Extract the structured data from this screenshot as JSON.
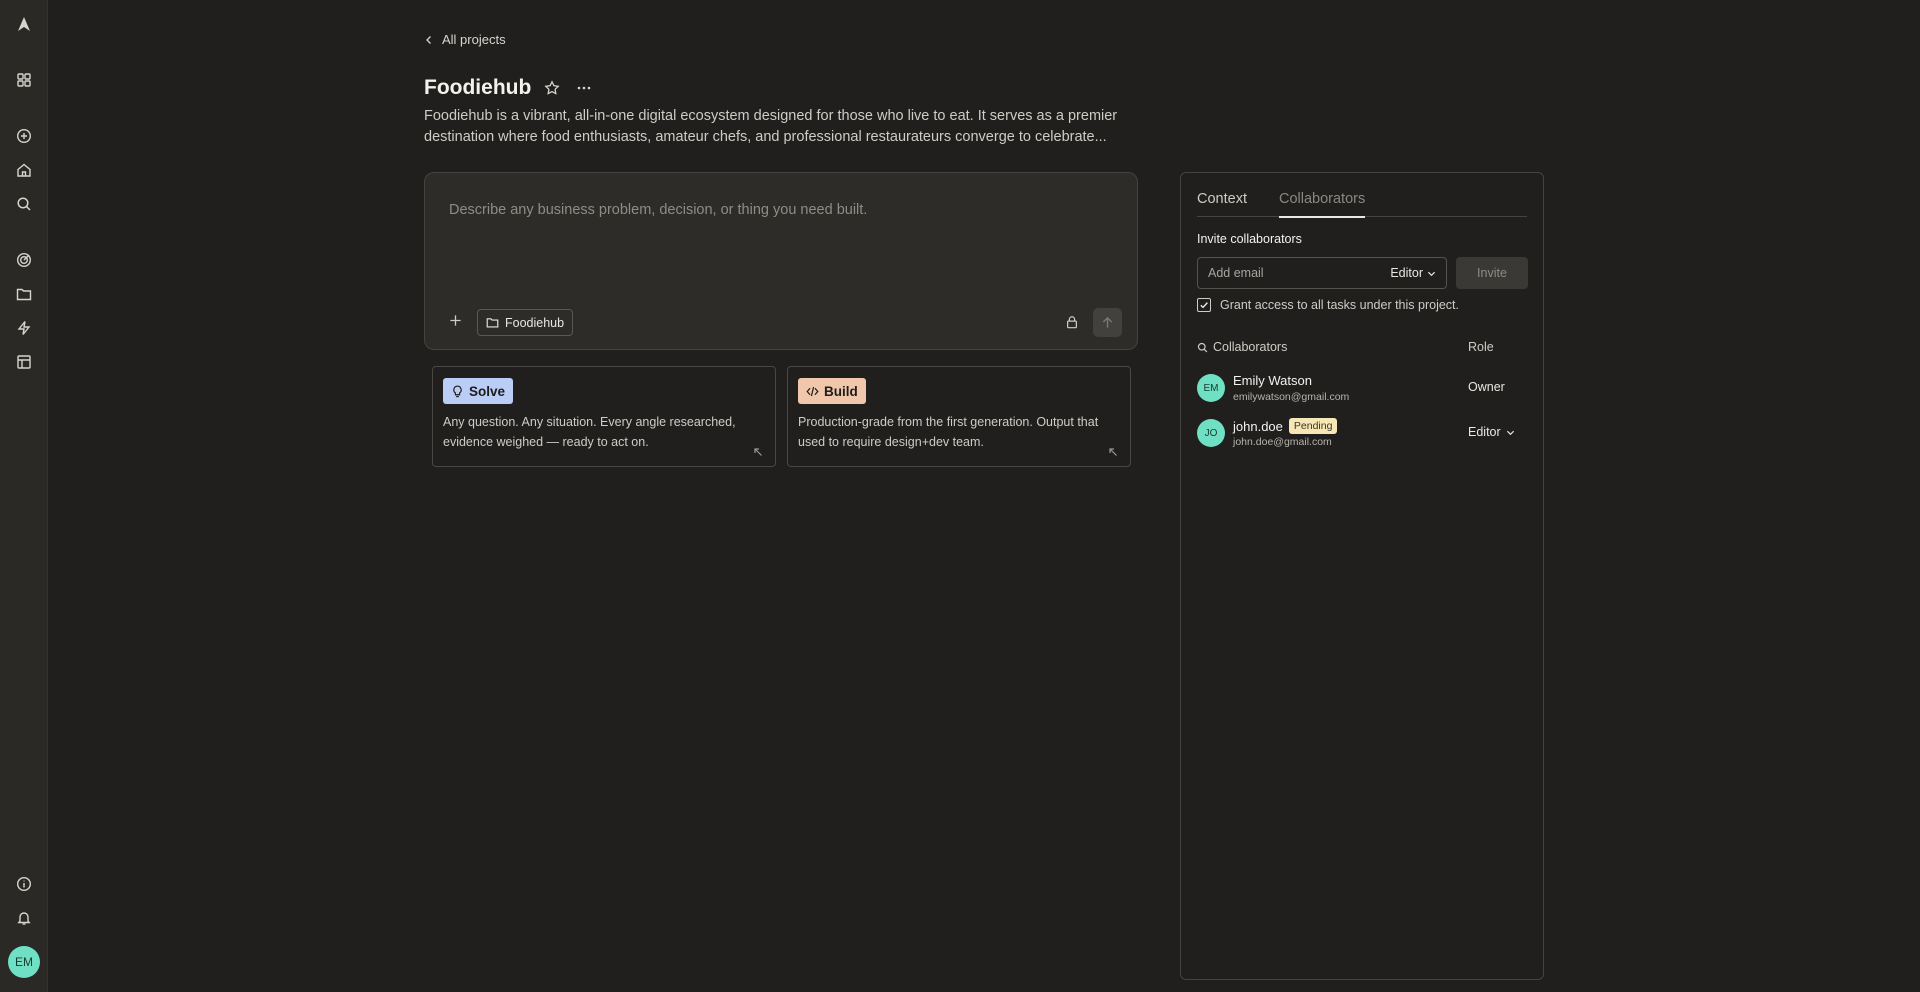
{
  "nav": {
    "back_label": "All projects"
  },
  "project": {
    "title": "Foodiehub",
    "description": "Foodiehub is a vibrant, all-in-one digital ecosystem designed for those who live to eat. It serves as a premier destination where food enthusiasts, amateur chefs, and professional restaurateurs converge to celebrate..."
  },
  "composer": {
    "placeholder": "Describe any business problem, decision, or thing you need built.",
    "project_chip": "Foodiehub"
  },
  "modes": [
    {
      "label": "Solve",
      "description": "Any question. Any situation. Every angle researched, evidence weighed — ready to act on.",
      "color": "#b9cdf7"
    },
    {
      "label": "Build",
      "description": "Production-grade from the first generation. Output that used to require design+dev team.",
      "color": "#f0c7aa"
    }
  ],
  "panel": {
    "tabs": [
      "Context",
      "Collaborators"
    ],
    "active_tab": "Collaborators",
    "invite_label": "Invite collaborators",
    "email_placeholder": "Add email",
    "role_default": "Editor",
    "invite_button": "Invite",
    "grant_label": "Grant access to all tasks under this project.",
    "grant_checked": true,
    "list_header": "Collaborators",
    "role_header": "Role",
    "collaborators": [
      {
        "initials": "EM",
        "name": "Emily Watson",
        "email": "emilywatson@gmail.com",
        "role": "Owner",
        "pending": ""
      },
      {
        "initials": "JO",
        "name": "john.doe",
        "email": "john.doe@gmail.com",
        "role": "Editor",
        "pending": "Pending"
      }
    ]
  },
  "user": {
    "initials": "EM"
  },
  "colors": {
    "background": "#201f1d",
    "sidebar": "#2a2926",
    "avatar": "#6fe0c3",
    "pending_badge": "#f6e7b6"
  }
}
